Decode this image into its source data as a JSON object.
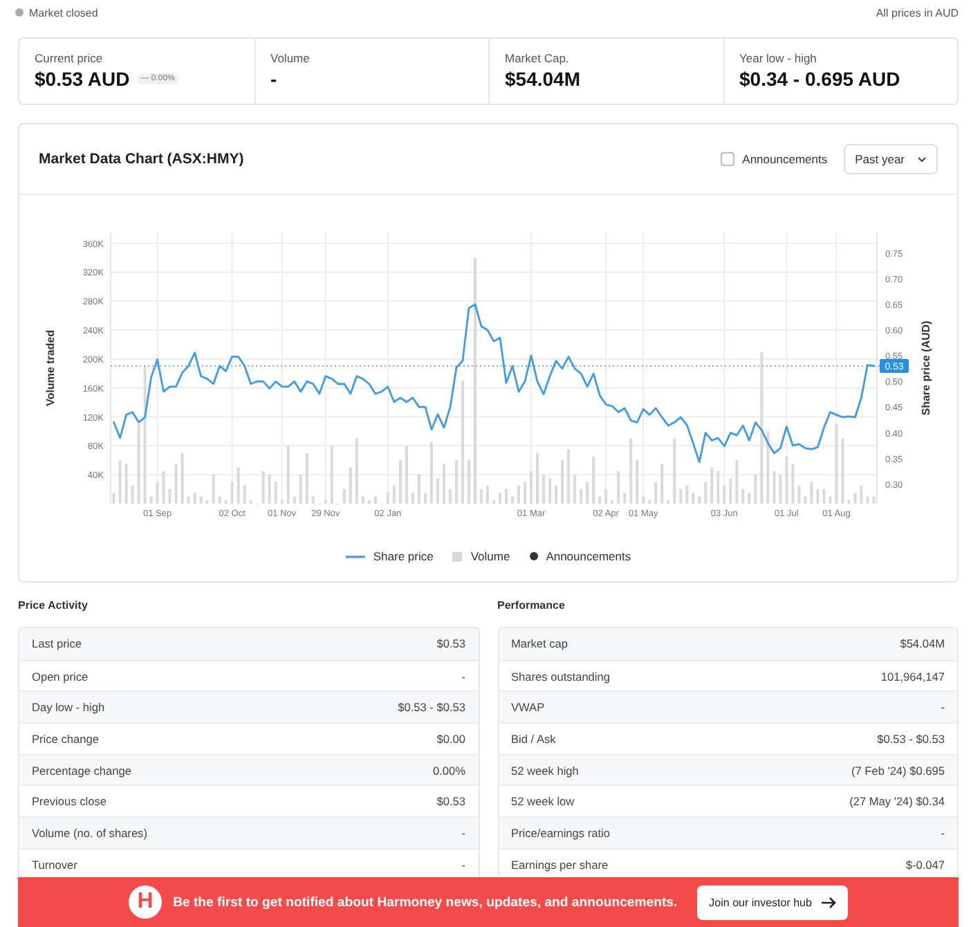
{
  "status": {
    "market_state": "Market closed",
    "currency_note": "All prices in AUD"
  },
  "stats": [
    {
      "label": "Current price",
      "value": "$0.53 AUD",
      "change": "— 0.00%"
    },
    {
      "label": "Volume",
      "value": "-"
    },
    {
      "label": "Market Cap.",
      "value": "$54.04M"
    },
    {
      "label": "Year low - high",
      "value": "$0.34 - 0.695 AUD"
    }
  ],
  "chart_panel": {
    "title": "Market Data Chart (ASX:HMY)",
    "announcements_toggle": {
      "label": "Announcements",
      "checked": false
    },
    "range_select": {
      "value": "Past year"
    },
    "announcements_legend": "Announcements",
    "chart_data": {
      "type": "line",
      "ylabel": "Volume traded",
      "y2label": "Share price (AUD)",
      "categories": [
        null,
        null,
        null,
        null,
        null,
        null,
        null,
        "01 Sep",
        null,
        null,
        null,
        null,
        null,
        null,
        null,
        null,
        null,
        null,
        null,
        "02 Oct",
        null,
        null,
        null,
        null,
        null,
        null,
        null,
        "01 Nov",
        null,
        null,
        null,
        null,
        null,
        null,
        "29 Nov",
        null,
        null,
        null,
        null,
        null,
        null,
        null,
        null,
        null,
        "02 Jan",
        null,
        null,
        null,
        null,
        null,
        null,
        null,
        null,
        null,
        null,
        null,
        null,
        null,
        null,
        null,
        null,
        null,
        null,
        null,
        null,
        null,
        null,
        "01 Mar",
        null,
        null,
        null,
        null,
        null,
        null,
        null,
        null,
        null,
        null,
        null,
        "02 Apr",
        null,
        null,
        null,
        null,
        null,
        "01 May",
        null,
        null,
        null,
        null,
        null,
        null,
        null,
        null,
        null,
        null,
        null,
        null,
        "03 Jun",
        null,
        null,
        null,
        null,
        null,
        null,
        null,
        null,
        null,
        "01 Jul",
        null,
        null,
        null,
        null,
        null,
        null,
        null,
        "01 Aug",
        null,
        null,
        null,
        null,
        null,
        null
      ],
      "series": [
        {
          "name": "Share price",
          "type": "line",
          "color": "#3d9be9",
          "axis": "y2",
          "values": [
            0.42,
            0.39,
            0.435,
            0.44,
            0.42,
            0.43,
            0.508,
            0.543,
            0.48,
            0.49,
            0.49,
            0.517,
            0.53,
            0.556,
            0.51,
            0.505,
            0.495,
            0.53,
            0.52,
            0.548,
            0.548,
            0.53,
            0.495,
            0.5,
            0.5,
            0.486,
            0.5,
            0.49,
            0.49,
            0.5,
            0.48,
            0.5,
            0.495,
            0.476,
            0.51,
            0.505,
            0.495,
            0.495,
            0.476,
            0.51,
            0.505,
            0.495,
            0.476,
            0.48,
            0.49,
            0.46,
            0.468,
            0.46,
            0.468,
            0.45,
            0.45,
            0.406,
            0.436,
            0.41,
            0.45,
            0.527,
            0.54,
            0.643,
            0.65,
            0.607,
            0.6,
            0.578,
            0.585,
            0.497,
            0.53,
            0.48,
            0.5,
            0.55,
            0.5,
            0.475,
            0.51,
            0.54,
            0.525,
            0.548,
            0.525,
            0.515,
            0.49,
            0.515,
            0.473,
            0.455,
            0.452,
            0.44,
            0.448,
            0.424,
            0.42,
            0.446,
            0.435,
            0.448,
            0.43,
            0.414,
            0.42,
            0.43,
            0.415,
            0.38,
            0.343,
            0.4,
            0.385,
            0.39,
            0.374,
            0.4,
            0.395,
            0.414,
            0.385,
            0.42,
            0.405,
            0.38,
            0.36,
            0.37,
            0.412,
            0.375,
            0.378,
            0.37,
            0.368,
            0.372,
            0.41,
            0.44,
            0.435,
            0.43,
            0.432,
            0.43,
            0.468,
            0.532,
            0.53
          ]
        },
        {
          "name": "Volume",
          "type": "bar",
          "color": "#d9d9d9",
          "values": [
            15,
            60,
            55,
            25,
            110,
            190,
            10,
            30,
            45,
            20,
            55,
            70,
            10,
            15,
            10,
            5,
            40,
            10,
            5,
            30,
            50,
            25,
            5,
            0,
            45,
            40,
            30,
            5,
            80,
            10,
            40,
            70,
            10,
            0,
            5,
            80,
            0,
            20,
            50,
            90,
            10,
            5,
            10,
            0,
            15,
            25,
            60,
            80,
            15,
            40,
            15,
            85,
            35,
            55,
            20,
            60,
            170,
            60,
            340,
            20,
            25,
            5,
            15,
            20,
            10,
            25,
            30,
            45,
            70,
            40,
            35,
            25,
            60,
            75,
            40,
            20,
            30,
            65,
            10,
            20,
            5,
            45,
            15,
            90,
            60,
            10,
            5,
            30,
            55,
            5,
            90,
            20,
            25,
            15,
            10,
            30,
            50,
            45,
            25,
            35,
            60,
            20,
            15,
            40,
            210,
            100,
            45,
            40,
            65,
            55,
            25,
            10,
            30,
            20,
            20,
            10,
            110,
            90,
            5,
            15,
            25,
            10,
            10
          ]
        }
      ],
      "ylim": [
        0,
        375
      ],
      "y2lim": [
        0.262,
        0.79
      ],
      "yticks": [
        {
          "value": 40,
          "label": "40K"
        },
        {
          "value": 80,
          "label": "80K"
        },
        {
          "value": 120,
          "label": "120K"
        },
        {
          "value": 160,
          "label": "160K"
        },
        {
          "value": 200,
          "label": "200K"
        },
        {
          "value": 240,
          "label": "240K"
        },
        {
          "value": 280,
          "label": "280K"
        },
        {
          "value": 320,
          "label": "320K"
        },
        {
          "value": 360,
          "label": "360K"
        }
      ],
      "y2ticks": [
        {
          "value": 0.3,
          "label": "0.30"
        },
        {
          "value": 0.35,
          "label": "0.35"
        },
        {
          "value": 0.4,
          "label": "0.40"
        },
        {
          "value": 0.45,
          "label": "0.45"
        },
        {
          "value": 0.5,
          "label": "0.50"
        },
        {
          "value": 0.55,
          "label": "0.55"
        },
        {
          "value": 0.6,
          "label": "0.60"
        },
        {
          "value": 0.65,
          "label": "0.65"
        },
        {
          "value": 0.7,
          "label": "0.70"
        },
        {
          "value": 0.75,
          "label": "0.75"
        }
      ],
      "grid": true,
      "ref_lines": [
        {
          "value": 0.53,
          "axis": "y2"
        }
      ],
      "annotations": [
        "0.53"
      ]
    }
  },
  "tables": [
    {
      "title": "Price Activity",
      "rows": [
        {
          "label": "Last price",
          "value": "$0.53"
        },
        {
          "label": "Open price",
          "value": "-"
        },
        {
          "label": "Day low - high",
          "value": "$0.53 - $0.53"
        },
        {
          "label": "Price change",
          "value": "$0.00"
        },
        {
          "label": "Percentage change",
          "value": "0.00%"
        },
        {
          "label": "Previous close",
          "value": "$0.53"
        },
        {
          "label": "Volume (no. of shares)",
          "value": "-"
        },
        {
          "label": "Turnover",
          "value": "-"
        }
      ]
    },
    {
      "title": "Performance",
      "rows": [
        {
          "label": "Market cap",
          "value": "$54.04M"
        },
        {
          "label": "Shares outstanding",
          "value": "101,964,147"
        },
        {
          "label": "VWAP",
          "value": "-"
        },
        {
          "label": "Bid / Ask",
          "value": "$0.53 - $0.53"
        },
        {
          "label": "52 week high",
          "value": "(7 Feb '24) $0.695"
        },
        {
          "label": "52 week low",
          "value": "(27 May '24) $0.34"
        },
        {
          "label": "Price/earnings ratio",
          "value": "-"
        },
        {
          "label": "Earnings per share",
          "value": "$-0.047"
        }
      ]
    }
  ],
  "banner": {
    "logo_letter": "H",
    "message": "Be the first to get notified about Harmoney news, updates, and announcements.",
    "button": "Join our investor hub"
  }
}
